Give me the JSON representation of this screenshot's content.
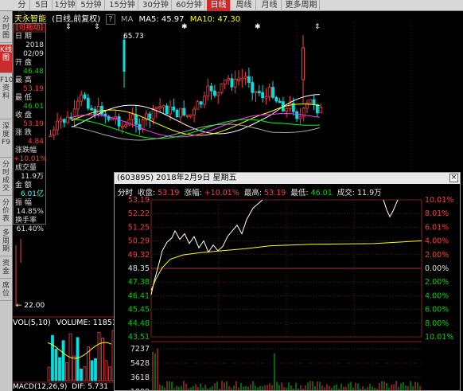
{
  "period_tabs": [
    "分时",
    "5日",
    "1分钟",
    "5分钟",
    "15分钟",
    "30分钟",
    "60分钟",
    "日线",
    "周线",
    "月线",
    "更多周期"
  ],
  "period_active": "日线",
  "sidebar_tabs": [
    "分时图",
    "K线图",
    "F10资料",
    "深度F9",
    "分时成交",
    "分价表",
    "多周期",
    "资金",
    "席位"
  ],
  "sidebar_active": "K线图",
  "title": {
    "stock": "天永智能",
    "mode": "(日线,前复权)",
    "help": "?",
    "ma": "MA",
    "ma5": "MA5: 45.97",
    "ma10": "MA10: 47.30"
  },
  "kchart": {
    "high_label": "65.73",
    "low_label": "22.00"
  },
  "info": {
    "header": "[可拖动]",
    "rows": [
      {
        "label": "日 期",
        "value": "2018",
        "cls": "white"
      },
      {
        "label": "",
        "value": "02/09",
        "cls": "white"
      },
      {
        "label": "开 盘",
        "value": "46.48",
        "cls": "green"
      },
      {
        "label": "最 高",
        "value": "53.19",
        "cls": "red"
      },
      {
        "label": "最 低",
        "value": "46.01",
        "cls": "green"
      },
      {
        "label": "收 盘",
        "value": "53.19",
        "cls": "red"
      },
      {
        "label": "涨 跌",
        "value": "4.84",
        "cls": "red"
      },
      {
        "label": "涨跌幅",
        "value": "+10.01%",
        "cls": "red"
      },
      {
        "label": "成交量",
        "value": "11.9万",
        "cls": "white"
      },
      {
        "label": "金 额",
        "value": "6.01亿",
        "cls": "cyan"
      },
      {
        "label": "振 幅",
        "value": "14.85%",
        "cls": "white"
      },
      {
        "label": "换手率",
        "value": "61.40%",
        "cls": "white"
      }
    ]
  },
  "minute": {
    "title": "(603895) 2018年2月9日 星期五",
    "close": "×",
    "info_label_time": "分时",
    "close_label": "收盘:",
    "close_value": "53.19",
    "chg_label": "涨幅:",
    "chg_value": "+10.01%",
    "high_label": "最高:",
    "high_value": "53.19",
    "low_label": "最低:",
    "low_value": "46.01",
    "vol_label": "成交:",
    "vol_value": "11.9万",
    "left_axis": [
      "53.19",
      "52.22",
      "51.25",
      "50.29",
      "49.32",
      "48.35",
      "47.38",
      "46.41",
      "45.45",
      "44.48",
      "43.51"
    ],
    "right_axis": [
      "10.01%",
      "8.01%",
      "6.01%",
      "4.00%",
      "2.00%",
      "0.00%",
      "2.00%",
      "4.00%",
      "6.00%",
      "8.00%",
      "10.01%"
    ],
    "vol_axis": [
      "7237",
      "5428",
      "3618",
      "1809"
    ]
  },
  "vol_panel": {
    "label": "VOL(5,10)",
    "volume": "VOLUME: 11851"
  },
  "macd_panel": {
    "label": "MACD(12,26,9)",
    "dif": "DIF: 5.731"
  }
}
